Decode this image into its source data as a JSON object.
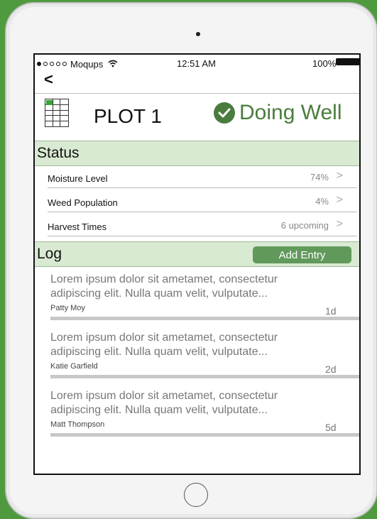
{
  "status_bar": {
    "carrier": "Moqups",
    "time": "12:51 AM",
    "battery": "100%",
    "signal_dots_filled": 1,
    "signal_dots_total": 5
  },
  "nav": {
    "back_glyph": "<",
    "back_icon": "chevron-left-icon"
  },
  "plot": {
    "title": "PLOT 1",
    "health_label": "Doing Well",
    "health_color": "#4a7c3e",
    "health_icon": "check-circle-icon"
  },
  "status": {
    "heading": "Status",
    "rows": [
      {
        "label": "Moisture Level",
        "value": "74%"
      },
      {
        "label": "Weed Population",
        "value": "4%"
      },
      {
        "label": "Harvest Times",
        "value": "6 upcoming"
      }
    ],
    "chevron_glyph": ">"
  },
  "log": {
    "heading": "Log",
    "add_label": "Add Entry",
    "entries": [
      {
        "text": "Lorem ipsum dolor sit ametamet, consectetur adipiscing elit. Nulla quam velit, vulputate...",
        "author": "Patty Moy",
        "age": "1d"
      },
      {
        "text": "Lorem ipsum dolor sit ametamet, consectetur adipiscing elit. Nulla quam velit, vulputate...",
        "author": "Katie Garfield",
        "age": "2d"
      },
      {
        "text": "Lorem ipsum dolor sit ametamet, consectetur adipiscing elit. Nulla quam velit, vulputate...",
        "author": "Matt Thompson",
        "age": "5d"
      }
    ]
  },
  "colors": {
    "background": "#4f9a3f",
    "section_header": "#d9ead2",
    "button": "#61995b"
  }
}
